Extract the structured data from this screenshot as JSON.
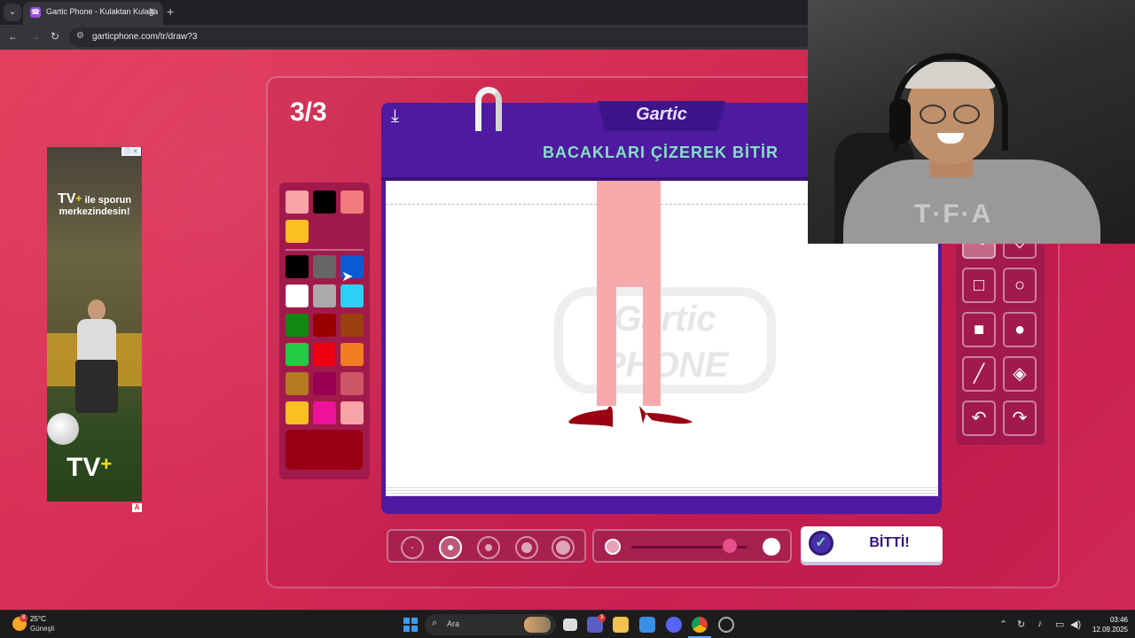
{
  "browser": {
    "tab_title": "Gartic Phone - Kulaktan Kulağa",
    "tab_close": "✕",
    "new_tab": "+",
    "url": "garticphone.com/tr/draw?3"
  },
  "ad": {
    "headline_brand": "TV",
    "headline": "ile sporun merkezindesin!",
    "bottom_logo": "TV",
    "plus": "+",
    "badge": "A",
    "corner": "ⓘ ✕"
  },
  "game": {
    "round": "3/3",
    "logo": "Gartic",
    "prompt": "BACAKLARI ÇİZEREK BİTİR",
    "watermark": "Gartic PHONE",
    "done_label": "BİTTİ!",
    "palette_top": [
      "#f8a3a8",
      "#000000",
      "#f27a7d",
      "#fbbf24"
    ],
    "palette_main": [
      "#000000",
      "#666666",
      "#0c5ad1",
      "#ffffff",
      "#aaaaaa",
      "#2dd0f5",
      "#118811",
      "#990000",
      "#99400e",
      "#22cc44",
      "#ee0011",
      "#f27d22",
      "#b57a22",
      "#990055",
      "#cc5566",
      "#fbbf24",
      "#ee1199",
      "#f8a3a8"
    ],
    "current_color": "#9a0012",
    "tools": [
      "pen-tool",
      "eraser-tool",
      "rect-outline-tool",
      "circle-outline-tool",
      "rect-fill-tool",
      "circle-fill-tool",
      "line-tool",
      "fill-bucket-tool",
      "undo-tool",
      "redo-tool"
    ],
    "brush_sizes_selected": 2,
    "opacity": 0.85
  },
  "taskbar": {
    "temp": "25°C",
    "weather": "Güneşli",
    "search_placeholder": "Ara",
    "time": "03:46",
    "date": "12.09.2025",
    "weather_badge": "8",
    "teams_badge": "3"
  }
}
